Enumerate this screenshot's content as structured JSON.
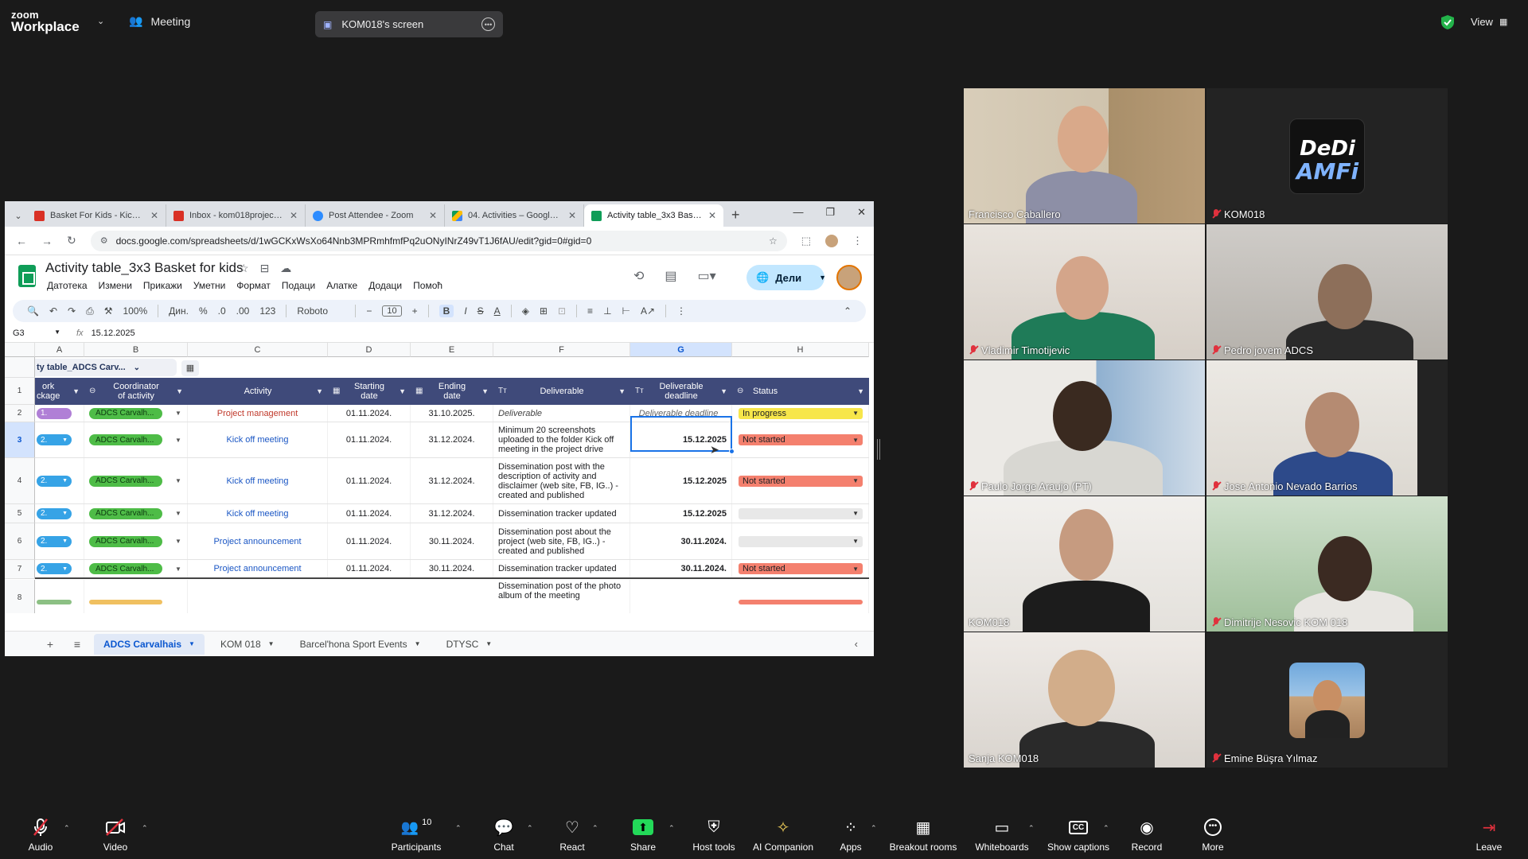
{
  "zoom": {
    "logo_line1": "zoom",
    "logo_line2": "Workplace",
    "meeting_label": "Meeting",
    "shared_screen_label": "KOM018's screen",
    "view_label": "View"
  },
  "browser": {
    "tabs": [
      {
        "label": "Basket For Kids - Kick-Off",
        "icon": "gmail-icon",
        "color": "#d93025"
      },
      {
        "label": "Inbox - kom018projects@",
        "icon": "gmail-icon",
        "color": "#d93025"
      },
      {
        "label": "Post Attendee - Zoom",
        "icon": "zoom-icon",
        "color": "#2d8cff"
      },
      {
        "label": "04. Activities – Google ди",
        "icon": "drive-icon",
        "color": "#fbbc04"
      },
      {
        "label": "Activity table_3x3 Basket",
        "icon": "sheets-icon",
        "color": "#0f9d58"
      }
    ],
    "url": "docs.google.com/spreadsheets/d/1wGCKxWsXo64Nnb3MPRmhfmfPq2uONyINrZ49vT1J6fAU/edit?gid=0#gid=0"
  },
  "sheet": {
    "title": "Activity table_3x3  Basket for kids",
    "menu": [
      "Датотека",
      "Измени",
      "Прикажи",
      "Уметни",
      "Формат",
      "Подаци",
      "Алатке",
      "Додаци",
      "Помоћ"
    ],
    "share_label": "Дели",
    "toolbar": {
      "zoom": "100%",
      "currency": "Дин.",
      "percent": "%",
      "dec_minus": ".0",
      "dec_plus": ".00",
      "num_format": "123",
      "font": "Roboto",
      "font_size": "10"
    },
    "cell_ref": "G3",
    "formula_value": "15.12.2025",
    "columns": [
      "A",
      "B",
      "C",
      "D",
      "E",
      "F",
      "G",
      "H"
    ],
    "table_name": "ty table_ADCS Carv...",
    "headers": {
      "a": "ork\nckage",
      "b": "Coordinator\nof activity",
      "c": "Activity",
      "d": "Starting\ndate",
      "e": "Ending\ndate",
      "f": "Deliverable",
      "g": "Deliverable\ndeadline",
      "h": "Status"
    },
    "rows": [
      {
        "num": "2",
        "a": "1.",
        "a_color": "#b07fd6",
        "b": "ADCS Carvalh...",
        "c": "Project management",
        "d": "01.11.2024.",
        "e": "31.10.2025.",
        "f": "Deliverable",
        "g": "Deliverable deadline",
        "h": "In progress",
        "h_color": "#f7e64a"
      },
      {
        "num": "3",
        "a": "2.",
        "a_color": "#36a3e6",
        "b": "ADCS Carvalh...",
        "c": "Kick off meeting",
        "d": "01.11.2024.",
        "e": "31.12.2024.",
        "f": "Minimum 20 screenshots uploaded to the folder Kick off meeting in the project drive",
        "g": "15.12.2025",
        "h": "Not started",
        "h_color": "#f4806e"
      },
      {
        "num": "4",
        "a": "2.",
        "a_color": "#36a3e6",
        "b": "ADCS Carvalh...",
        "c": "Kick off meeting",
        "d": "01.11.2024.",
        "e": "31.12.2024.",
        "f": "Dissemination post with the description of activity and disclaimer (web site, FB, IG..) - created and published",
        "g": "15.12.2025",
        "h": "Not started",
        "h_color": "#f4806e"
      },
      {
        "num": "5",
        "a": "2.",
        "a_color": "#36a3e6",
        "b": "ADCS Carvalh...",
        "c": "Kick off meeting",
        "d": "01.11.2024.",
        "e": "31.12.2024.",
        "f": "Dissemination tracker updated",
        "g": "15.12.2025",
        "h": "",
        "h_color": "#e8e8e8"
      },
      {
        "num": "6",
        "a": "2.",
        "a_color": "#36a3e6",
        "b": "ADCS Carvalh...",
        "c": "Project announcement",
        "d": "01.11.2024.",
        "e": "30.11.2024.",
        "f": "Dissemination post about the project (web site, FB, IG..) - created and published",
        "g": "30.11.2024.",
        "h": "",
        "h_color": "#e8e8e8"
      },
      {
        "num": "7",
        "a": "2.",
        "a_color": "#36a3e6",
        "b": "ADCS Carvalh...",
        "c": "Project announcement",
        "d": "01.11.2024.",
        "e": "30.11.2024.",
        "f": "Dissemination tracker updated",
        "g": "30.11.2024.",
        "h": "Not started",
        "h_color": "#f4806e"
      },
      {
        "num": "8",
        "a": "",
        "a_color": "#8cc084",
        "b": "",
        "c": "",
        "d": "",
        "e": "",
        "f": "Dissemination post of the photo album of the meeting",
        "g": "",
        "h": "",
        "h_color": "#f4806e"
      }
    ],
    "sheet_tabs": [
      "ADCS Carvalhais",
      "KOM 018",
      "Barcel'hona Sport Events",
      "DTYSC"
    ]
  },
  "participants": [
    {
      "name": "Francisco Caballero",
      "muted": false,
      "speaking": false
    },
    {
      "name": "KOM018",
      "muted": true,
      "speaking": false
    },
    {
      "name": "Vladimir Timotijevic",
      "muted": true,
      "speaking": false
    },
    {
      "name": "Pedro jovem ADCS",
      "muted": true,
      "speaking": false
    },
    {
      "name": "Paulo Jorge Araujo (PT)",
      "muted": true,
      "speaking": false
    },
    {
      "name": "Jose Antonio Nevado Barrios",
      "muted": true,
      "speaking": false
    },
    {
      "name": "KOM018",
      "muted": false,
      "speaking": false
    },
    {
      "name": "Dimitrije Nesovic KOM 018",
      "muted": true,
      "speaking": false
    },
    {
      "name": "Sanja KOM018",
      "muted": false,
      "speaking": true
    },
    {
      "name": "Emine Büşra Yılmaz",
      "muted": true,
      "speaking": false
    }
  ],
  "toolbar": {
    "audio": "Audio",
    "video": "Video",
    "participants": "Participants",
    "participant_count": "10",
    "chat": "Chat",
    "react": "React",
    "share": "Share",
    "host_tools": "Host tools",
    "ai_companion": "AI Companion",
    "apps": "Apps",
    "breakout_rooms": "Breakout rooms",
    "whiteboards": "Whiteboards",
    "show_captions": "Show captions",
    "record": "Record",
    "more": "More",
    "leave": "Leave"
  }
}
